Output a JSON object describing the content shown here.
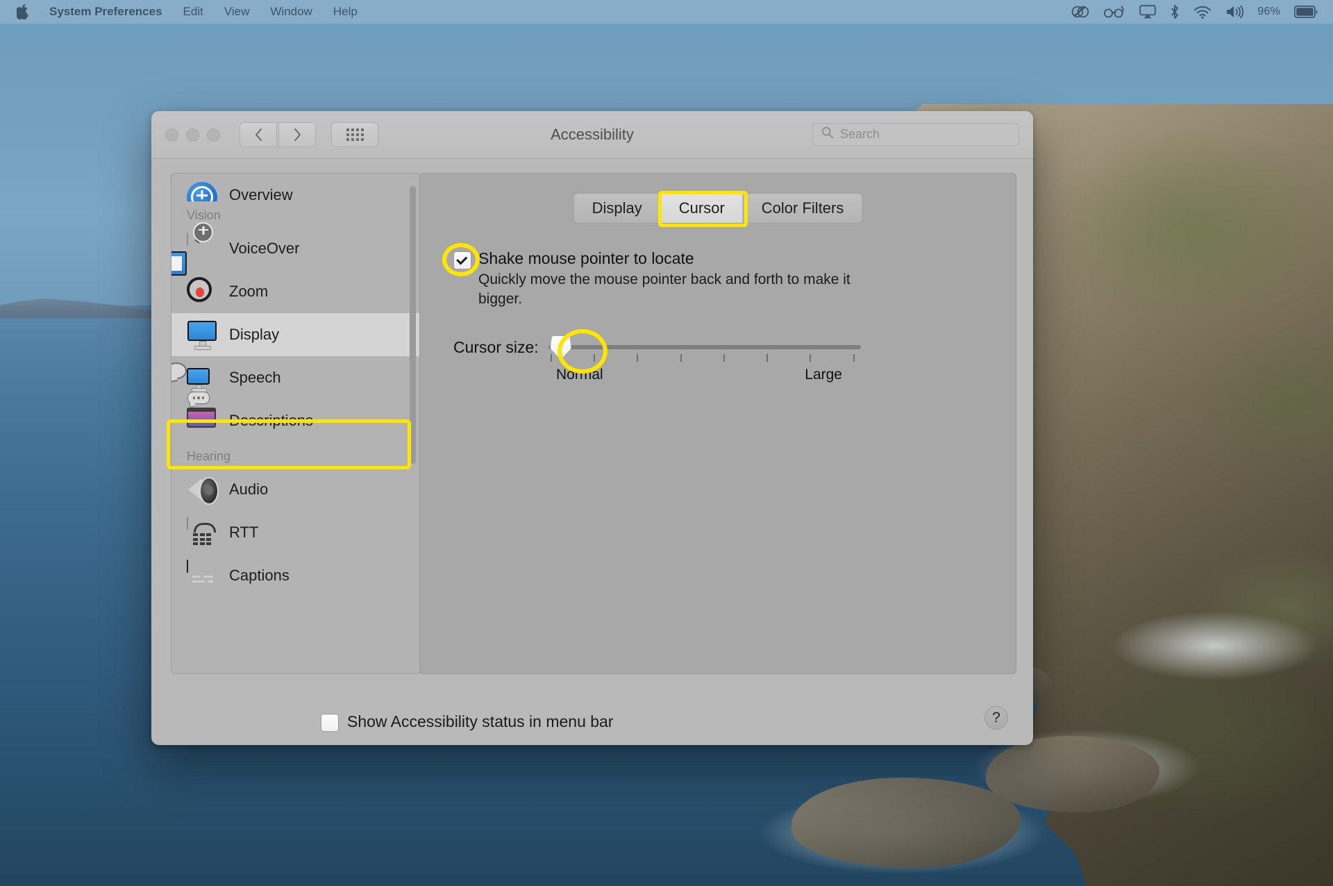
{
  "menubar": {
    "apple_icon": "apple-logo",
    "items": [
      {
        "label": "System Preferences",
        "bold": true
      },
      {
        "label": "Edit",
        "bold": false
      },
      {
        "label": "View",
        "bold": false
      },
      {
        "label": "Window",
        "bold": false
      },
      {
        "label": "Help",
        "bold": false
      }
    ],
    "status_icons": [
      "creative-cloud-icon",
      "glasses-icon",
      "airplay-icon",
      "bluetooth-icon",
      "wifi-icon",
      "volume-icon"
    ],
    "battery_percent": "96%",
    "text_color": "#3b5468"
  },
  "window": {
    "title": "Accessibility",
    "traffic_lights": [
      "close-button",
      "minimize-button",
      "zoom-button"
    ],
    "nav": {
      "back": "back-button",
      "forward": "forward-button",
      "grid": "show-all-button"
    },
    "search": {
      "placeholder": "Search",
      "value": ""
    }
  },
  "sidebar": {
    "groups": [
      {
        "label": "",
        "items": [
          {
            "label": "Overview",
            "icon": "accessibility-overview-icon",
            "selected": false,
            "clipped": true
          }
        ]
      },
      {
        "label": "Vision",
        "items": [
          {
            "label": "VoiceOver",
            "icon": "voiceover-icon",
            "selected": false
          },
          {
            "label": "Zoom",
            "icon": "zoom-magnifier-icon",
            "selected": false
          },
          {
            "label": "Display",
            "icon": "display-monitor-icon",
            "selected": true
          },
          {
            "label": "Speech",
            "icon": "speech-bubble-icon",
            "selected": false
          },
          {
            "label": "Descriptions",
            "icon": "descriptions-icon",
            "selected": false
          }
        ]
      },
      {
        "label": "Hearing",
        "items": [
          {
            "label": "Audio",
            "icon": "audio-speaker-icon",
            "selected": false
          },
          {
            "label": "RTT",
            "icon": "rtt-telephone-icon",
            "selected": false
          },
          {
            "label": "Captions",
            "icon": "captions-icon",
            "selected": false
          }
        ]
      }
    ]
  },
  "content": {
    "tabs": [
      {
        "label": "Display",
        "active": false
      },
      {
        "label": "Cursor",
        "active": true
      },
      {
        "label": "Color Filters",
        "active": false
      }
    ],
    "shake_pointer": {
      "checked": true,
      "title": "Shake mouse pointer to locate",
      "description": "Quickly move the mouse pointer back and forth to make it bigger."
    },
    "cursor_size": {
      "label": "Cursor size:",
      "min_label": "Normal",
      "max_label": "Large",
      "value_percent": 0,
      "tick_count": 8
    }
  },
  "footer": {
    "show_status_checkbox": {
      "checked": false,
      "label": "Show Accessibility status in menu bar"
    },
    "help_label": "?"
  },
  "highlights": {
    "color": "#ffe600",
    "targets": [
      "sidebar-display-row",
      "cursor-tab",
      "shake-pointer-checkbox",
      "cursor-size-slider-thumb"
    ]
  }
}
